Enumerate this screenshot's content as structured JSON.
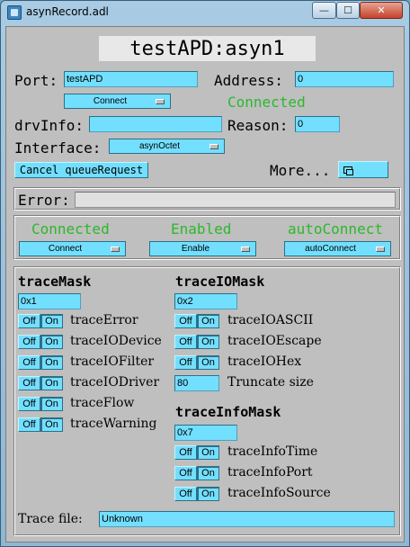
{
  "window": {
    "title": "asynRecord.adl",
    "min_glyph": "—",
    "max_glyph": "☐",
    "close_glyph": "✕"
  },
  "record": {
    "name": "testAPD:asyn1"
  },
  "port": {
    "label": "Port:",
    "value": "testAPD"
  },
  "address": {
    "label": "Address:",
    "value": "0"
  },
  "connect_menu": {
    "value": "Connect"
  },
  "status": {
    "connected": "Connected"
  },
  "drvinfo": {
    "label": "drvInfo:",
    "value": ""
  },
  "reason": {
    "label": "Reason:",
    "value": "0"
  },
  "interface": {
    "label": "Interface:",
    "value": "asynOctet"
  },
  "cancel_button": {
    "label": "Cancel queueRequest"
  },
  "more": {
    "label": "More..."
  },
  "error": {
    "label": "Error:",
    "value": ""
  },
  "conn_panel": {
    "connected_label": "Connected",
    "enabled_label": "Enabled",
    "autoconnect_label": "autoConnect",
    "connect_value": "Connect",
    "enable_value": "Enable",
    "autoconnect_value": "autoConnect"
  },
  "toggle_labels": {
    "off": "Off",
    "on": "On"
  },
  "trace_mask": {
    "heading": "traceMask",
    "value": "0x1",
    "items": [
      "traceError",
      "traceIODevice",
      "traceIOFilter",
      "traceIODriver",
      "traceFlow",
      "traceWarning"
    ]
  },
  "trace_io_mask": {
    "heading": "traceIOMask",
    "value": "0x2",
    "items": [
      "traceIOASCII",
      "traceIOEscape",
      "traceIOHex"
    ],
    "truncate_value": "80",
    "truncate_label": "Truncate size"
  },
  "trace_info_mask": {
    "heading": "traceInfoMask",
    "value": "0x7",
    "items": [
      "traceInfoTime",
      "traceInfoPort",
      "traceInfoSource"
    ]
  },
  "trace_file": {
    "label": "Trace file:",
    "value": "Unknown"
  },
  "colors": {
    "field": "#73dfff",
    "status_green": "#2cb82c",
    "background": "#bfbfbf"
  },
  "icons": {
    "more": "related-display-icon",
    "menu": "option-menu-icon"
  }
}
